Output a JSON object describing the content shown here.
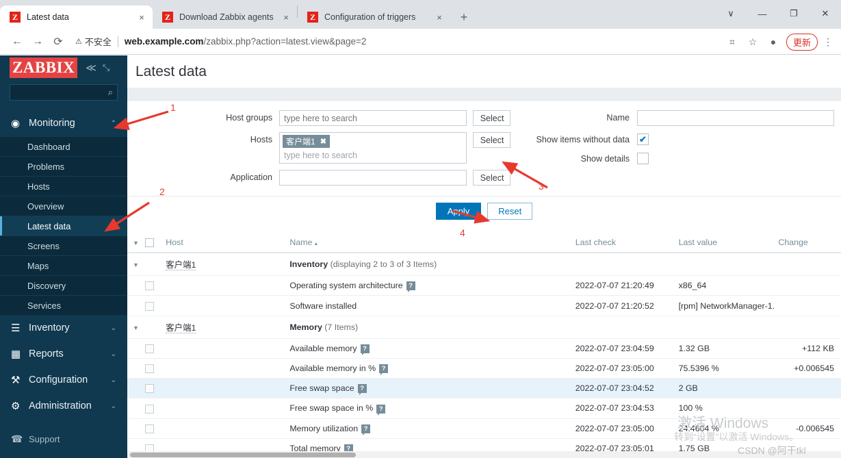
{
  "browser": {
    "tabs": [
      {
        "title": "Latest data",
        "favicon": "Z",
        "active": true,
        "close_label": "×"
      },
      {
        "title": "Download Zabbix agents",
        "favicon": "Z",
        "active": false,
        "close_label": "×"
      },
      {
        "title": "Configuration of triggers",
        "favicon": "Z",
        "active": false,
        "close_label": "×"
      }
    ],
    "new_tab_label": "+",
    "window_controls": {
      "expand": "∨",
      "minimize": "—",
      "maximize": "❐",
      "close": "✕"
    },
    "nav": {
      "back": "←",
      "forward": "→",
      "reload": "⟳"
    },
    "security": {
      "icon_label": "⚠",
      "text": "不安全"
    },
    "url": {
      "host": "web.example.com",
      "path": "/zabbix.php?action=latest.view&page=2"
    },
    "omni_right": {
      "translate": "⌗",
      "bookmark": "☆",
      "profile": "●",
      "update_label": "更新",
      "menu": "⋮"
    }
  },
  "sidebar": {
    "logo": "ZABBIX",
    "collapse_label": "≪",
    "kiosk_label": "⤡",
    "search_placeholder": "",
    "search_icon": "⌕",
    "sections": [
      {
        "label": "Monitoring",
        "icon": "◉",
        "chevron": "⌃",
        "expanded": true,
        "items": [
          {
            "label": "Dashboard",
            "selected": false
          },
          {
            "label": "Problems",
            "selected": false
          },
          {
            "label": "Hosts",
            "selected": false
          },
          {
            "label": "Overview",
            "selected": false
          },
          {
            "label": "Latest data",
            "selected": true
          },
          {
            "label": "Screens",
            "selected": false
          },
          {
            "label": "Maps",
            "selected": false
          },
          {
            "label": "Discovery",
            "selected": false
          },
          {
            "label": "Services",
            "selected": false
          }
        ]
      },
      {
        "label": "Inventory",
        "icon": "☰",
        "chevron": "⌄",
        "expanded": false,
        "items": []
      },
      {
        "label": "Reports",
        "icon": "▦",
        "chevron": "⌄",
        "expanded": false,
        "items": []
      },
      {
        "label": "Configuration",
        "icon": "⚒",
        "chevron": "⌄",
        "expanded": false,
        "items": []
      },
      {
        "label": "Administration",
        "icon": "⚙",
        "chevron": "⌄",
        "expanded": false,
        "items": []
      }
    ],
    "support": {
      "label": "Support",
      "icon": "☎"
    }
  },
  "page": {
    "title": "Latest data"
  },
  "filter": {
    "host_groups": {
      "label": "Host groups",
      "value": "",
      "placeholder": "type here to search",
      "select_label": "Select"
    },
    "hosts": {
      "label": "Hosts",
      "chip": "客户端1",
      "chip_remove": "✖",
      "placeholder": "type here to search",
      "select_label": "Select"
    },
    "application": {
      "label": "Application",
      "value": "",
      "placeholder": "",
      "select_label": "Select"
    },
    "name": {
      "label": "Name",
      "value": "",
      "placeholder": ""
    },
    "show_items_without_data": {
      "label": "Show items without data",
      "checked": true,
      "tick": "✔"
    },
    "show_details": {
      "label": "Show details",
      "checked": false,
      "tick": ""
    },
    "apply_label": "Apply",
    "reset_label": "Reset"
  },
  "table": {
    "columns": {
      "expand": "▼",
      "host": "Host",
      "name": "Name",
      "name_sort": "▴",
      "last_check": "Last check",
      "last_value": "Last value",
      "change": "Change"
    },
    "groups": [
      {
        "expand": "▼",
        "host": "客户端1",
        "app_name": "Inventory",
        "app_count": "(displaying 2 to 3 of 3 Items)",
        "rows": [
          {
            "name": "Operating system architecture",
            "has_help": true,
            "last_check": "2022-07-07 21:20:49",
            "last_value": "x86_64",
            "change": "",
            "highlight": false
          },
          {
            "name": "Software installed",
            "has_help": false,
            "last_check": "2022-07-07 21:20:52",
            "last_value": "[rpm] NetworkManager-1....",
            "change": "",
            "highlight": false
          }
        ]
      },
      {
        "expand": "▼",
        "host": "客户端1",
        "app_name": "Memory",
        "app_count": "(7 Items)",
        "rows": [
          {
            "name": "Available memory",
            "has_help": true,
            "last_check": "2022-07-07 23:04:59",
            "last_value": "1.32 GB",
            "change": "+112 KB",
            "highlight": false
          },
          {
            "name": "Available memory in %",
            "has_help": true,
            "last_check": "2022-07-07 23:05:00",
            "last_value": "75.5396 %",
            "change": "+0.006545",
            "highlight": false
          },
          {
            "name": "Free swap space",
            "has_help": true,
            "last_check": "2022-07-07 23:04:52",
            "last_value": "2 GB",
            "change": "",
            "highlight": true
          },
          {
            "name": "Free swap space in %",
            "has_help": true,
            "last_check": "2022-07-07 23:04:53",
            "last_value": "100 %",
            "change": "",
            "highlight": false
          },
          {
            "name": "Memory utilization",
            "has_help": true,
            "last_check": "2022-07-07 23:05:00",
            "last_value": "24.4604 %",
            "change": "-0.006545",
            "highlight": false
          },
          {
            "name": "Total memory",
            "has_help": true,
            "last_check": "2022-07-07 23:05:01",
            "last_value": "1.75 GB",
            "change": "",
            "highlight": false
          }
        ]
      }
    ]
  },
  "annotations": [
    {
      "id": "1",
      "label": "1"
    },
    {
      "id": "2",
      "label": "2"
    },
    {
      "id": "3",
      "label": "3"
    },
    {
      "id": "4",
      "label": "4"
    }
  ],
  "watermark": {
    "line1": "激活 Windows",
    "line2": "转到“设置”以激活 Windows。",
    "credit": "CSDN @阿干tkl"
  },
  "colors": {
    "accent": "#0275b8",
    "brand_red": "#e54343",
    "sidebar": "#10394f",
    "annotation": "#e8392e"
  }
}
